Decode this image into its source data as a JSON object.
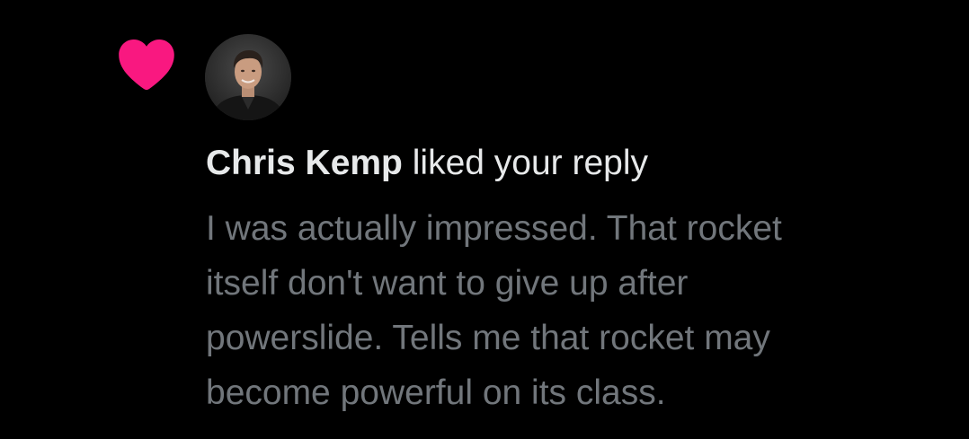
{
  "notification": {
    "type_icon": "heart-icon",
    "type_icon_color": "#f91880",
    "avatar": "user-avatar-photo",
    "user_name": "Chris Kemp",
    "action_text": "liked your reply",
    "reply_lines": [
      "I was actually impressed. That rocket",
      "itself don't want to give up after",
      "powerslide. Tells me that rocket may",
      "become powerful on its class."
    ]
  },
  "colors": {
    "background": "#000000",
    "primary_text": "#e7e9ea",
    "secondary_text": "#71767b",
    "like_pink": "#f91880"
  }
}
